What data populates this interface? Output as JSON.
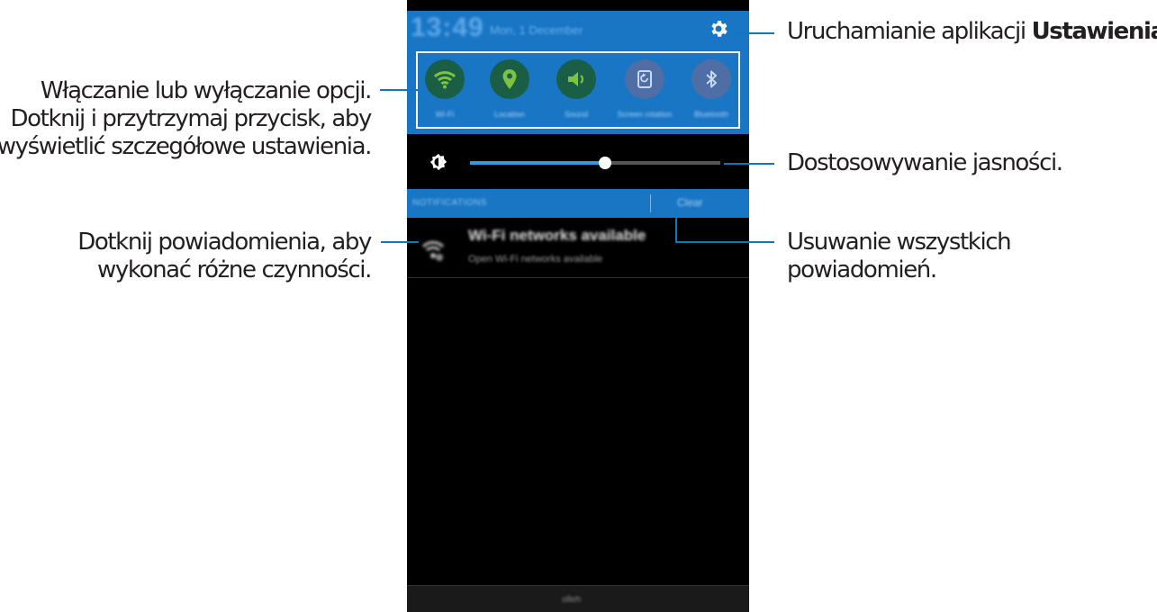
{
  "status_bar": {
    "time": "13:49",
    "date": "Mon, 1 December"
  },
  "quick_settings": [
    {
      "label": "Wi-Fi",
      "icon": "wifi-icon",
      "active": true
    },
    {
      "label": "Location",
      "icon": "location-icon",
      "active": true
    },
    {
      "label": "Sound",
      "icon": "sound-icon",
      "active": true
    },
    {
      "label": "Screen rotation",
      "icon": "screen-rotation-icon",
      "active": false
    },
    {
      "label": "Bluetooth",
      "icon": "bluetooth-icon",
      "active": false
    }
  ],
  "brightness": {
    "level": 0.54
  },
  "notifications": {
    "header": "NOTIFICATIONS",
    "clear_label": "Clear",
    "items": [
      {
        "title": "Wi-Fi networks available",
        "subtitle": "Open Wi-Fi networks available",
        "icon": "wifi-notification-icon"
      }
    ]
  },
  "bottom_bar": {
    "label": "olleh"
  },
  "callouts": {
    "settings_prefix": "Uruchamianie aplikacji ",
    "settings_bold": "Ustawienia",
    "settings_suffix": ".",
    "toggles_line1": "Włączanie lub wyłączanie opcji.",
    "toggles_line2": "Dotknij i przytrzymaj przycisk, aby",
    "toggles_line3": "wyświetlić szczegółowe ustawienia.",
    "brightness": "Dostosowywanie jasności.",
    "notification_line1": "Dotknij powiadomienia, aby",
    "notification_line2": "wykonać różne czynności.",
    "clear_line1": "Usuwanie wszystkich",
    "clear_line2": "powiadomień."
  },
  "colors": {
    "panel_blue": "#1976c5",
    "callout_line": "#0b78c0",
    "slider_fill": "#3498e0",
    "active_icon": "#7ec242"
  }
}
